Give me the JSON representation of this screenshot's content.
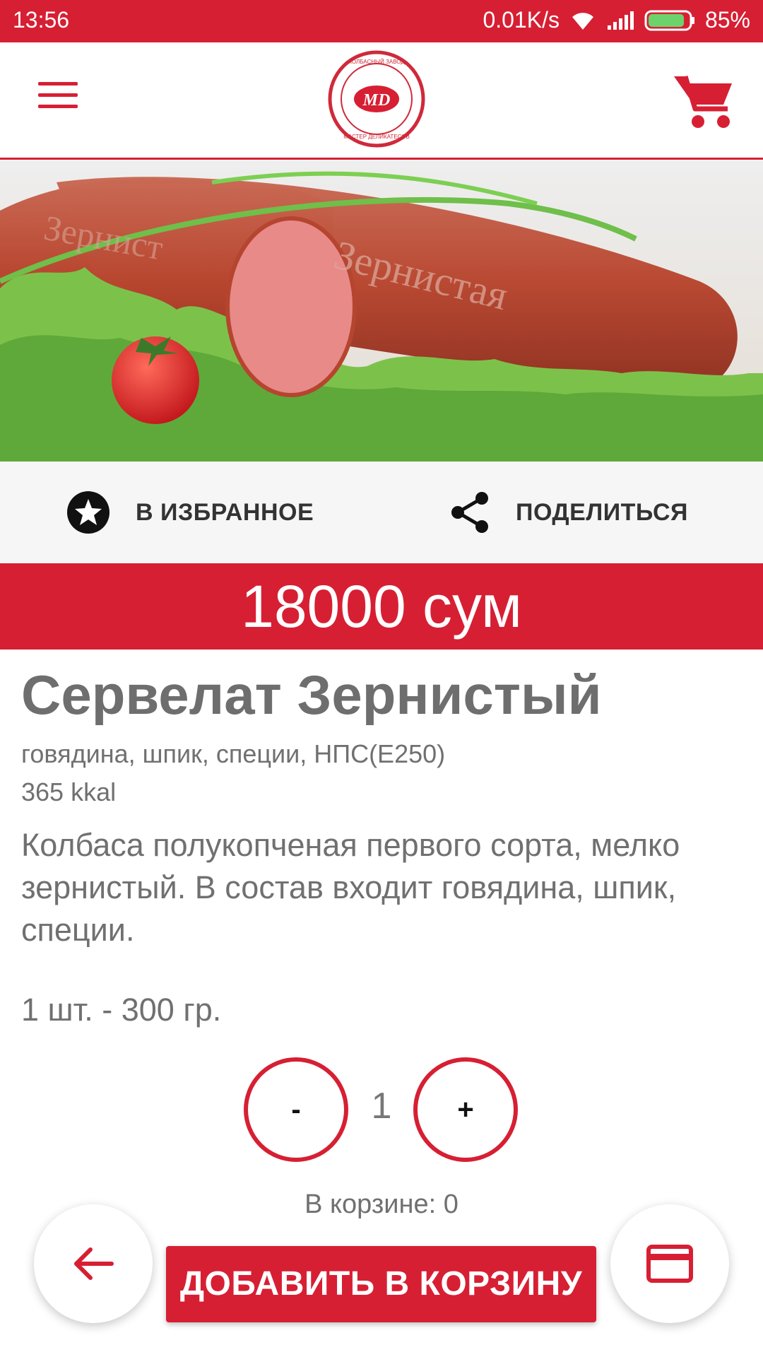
{
  "status_bar": {
    "time": "13:56",
    "speed": "0.01K/s",
    "battery": "85%"
  },
  "app_bar": {
    "logo_icon": "md-stamp-logo",
    "menu_icon": "hamburger-menu-icon",
    "cart_icon": "cart-icon"
  },
  "hero": {
    "image_icon": "salami-product-photo"
  },
  "actions": {
    "favorite_label": "В ИЗБРАННОЕ",
    "share_label": "ПОДЕЛИТЬСЯ"
  },
  "product": {
    "price": "18000 сум",
    "title": "Сервелат Зернистый",
    "ingredients": "говядина, шпик, специи, НПС(Е250)",
    "kcal": "365 kkal",
    "description": "Колбаса полукопченая первого сорта, мелко зернистый. В состав входит говядина, шпик, специи.",
    "portion": "1 шт. - 300 гр."
  },
  "quantity": {
    "minus_label": "-",
    "value": "1",
    "plus_label": "+"
  },
  "cart_info": "В корзине: 0",
  "bottom": {
    "add_to_cart_label": "ДОБАВИТЬ В КОРЗИНУ",
    "back_icon": "arrow-left-icon",
    "card_icon": "credit-card-icon"
  },
  "colors": {
    "accent": "#d71f33",
    "text_gray": "#707070"
  }
}
